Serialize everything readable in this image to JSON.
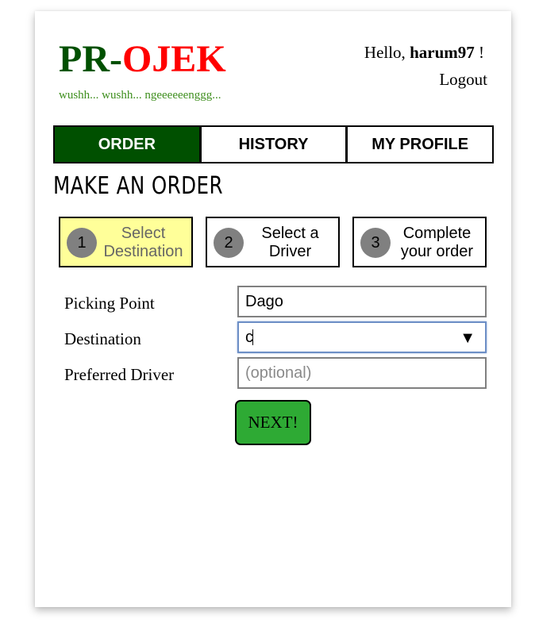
{
  "header": {
    "logo_part1": "PR",
    "logo_dash": "-",
    "logo_part2": "OJEK",
    "tagline": "wushh... wushh... ngeeeeeenggg...",
    "greeting_prefix": "Hello, ",
    "username": "harum97",
    "greeting_suffix": " !",
    "logout_label": "Logout"
  },
  "tabs": [
    {
      "label": "ORDER",
      "active": true
    },
    {
      "label": "HISTORY",
      "active": false
    },
    {
      "label": "MY PROFILE",
      "active": false
    }
  ],
  "page_title": "MAKE AN ORDER",
  "steps": [
    {
      "number": "1",
      "label_line1": "Select",
      "label_line2": "Destination",
      "active": true
    },
    {
      "number": "2",
      "label_line1": "Select a",
      "label_line2": "Driver",
      "active": false
    },
    {
      "number": "3",
      "label_line1": "Complete",
      "label_line2": "your order",
      "active": false
    }
  ],
  "form": {
    "picking_point_label": "Picking Point",
    "picking_point_value": "Dago",
    "destination_label": "Destination",
    "destination_value": "c",
    "dropdown_arrow": "▼",
    "preferred_driver_label": "Preferred Driver",
    "preferred_driver_placeholder": "(optional)",
    "next_label": "NEXT!"
  },
  "colors": {
    "brand_green": "#005000",
    "brand_red": "#ff0000",
    "tagline_green": "#3f8f1f",
    "active_step_bg": "#ffff99",
    "next_button_bg": "#2eaa34",
    "focus_border": "#6d8fc6"
  }
}
